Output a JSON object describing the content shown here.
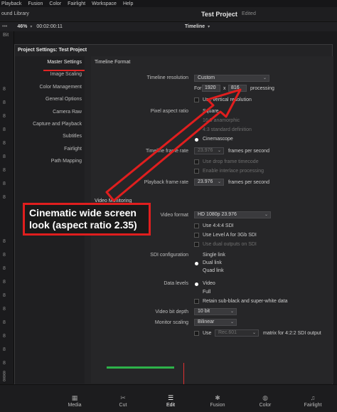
{
  "menu": [
    "Playback",
    "Fusion",
    "Color",
    "Fairlight",
    "Workspace",
    "Help"
  ],
  "titlebar": {
    "library": "ound Library",
    "project": "Test Project",
    "status": "Edited"
  },
  "toolbar": {
    "zoom": "46%",
    "timecode": "00:02:00:11",
    "timeline": "Timeline",
    "bit": "Bit"
  },
  "left_strip_numbers": [
    "8",
    "8",
    "8",
    "8",
    "8",
    "8",
    "8",
    "8",
    "8",
    "8",
    "8",
    "8",
    "8",
    "8",
    "8",
    "8",
    "8",
    "8",
    "8",
    "8",
    "8",
    "8"
  ],
  "dialog": {
    "title": "Project Settings:  Test Project",
    "nav": [
      "Master Settings",
      "Image Scaling",
      "Color Management",
      "General Options",
      "Camera Raw",
      "Capture and Playback",
      "Subtitles",
      "Fairlight",
      "Path Mapping"
    ],
    "timeline_format": {
      "heading": "Timeline Format",
      "resolution_label": "Timeline resolution",
      "resolution_value": "Custom",
      "for_label": "For",
      "width": "1920",
      "x": "x",
      "height": "816",
      "processing": "processing",
      "use_vertical": "Use vertical resolution",
      "pixel_aspect_label": "Pixel aspect ratio",
      "pixel_aspect_options": [
        "Square",
        "16:9 anamorphic",
        "4:3 standard definition",
        "Cinemascope"
      ],
      "frame_rate_label": "Timeline frame rate",
      "frame_rate_value": "23.976",
      "frame_rate_unit": "frames per second",
      "drop_frame": "Use drop frame timecode",
      "interlace": "Enable interlace processing",
      "playback_label": "Playback frame rate",
      "playback_value": "23.976",
      "playback_unit": "frames per second"
    },
    "video_monitoring": {
      "heading": "Video Monitoring",
      "format_label": "Video format",
      "format_value": "HD 1080p 23.976",
      "use_444": "Use 4:4:4 SDI",
      "use_level_a": "Use Level A for 3Gb SDI",
      "sdi_outputs": "Use dual outputs on SDI",
      "sdi_config_label": "SDI configuration",
      "sdi_options": [
        "Single link",
        "Dual link",
        "Quad link"
      ],
      "data_levels_label": "Data levels",
      "data_levels_options": [
        "Video",
        "Full"
      ],
      "retain": "Retain sub-black and super-white data",
      "bit_depth_label": "Video bit depth",
      "bit_depth_value": "10 bit",
      "scaling_label": "Monitor scaling",
      "scaling_value": "Bilinear",
      "use_label": "Use",
      "rec_value": "Rec.601",
      "matrix": "matrix for 4:2:2 SDI output"
    }
  },
  "bottom_nav": [
    {
      "label": "Media",
      "icon": "media-icon",
      "glyph": "▦"
    },
    {
      "label": "Cut",
      "icon": "cut-icon",
      "glyph": "✂"
    },
    {
      "label": "Edit",
      "icon": "edit-icon",
      "glyph": "☰"
    },
    {
      "label": "Fusion",
      "icon": "fusion-icon",
      "glyph": "✱"
    },
    {
      "label": "Color",
      "icon": "color-icon",
      "glyph": "◍"
    },
    {
      "label": "Fairlight",
      "icon": "fairlight-icon",
      "glyph": "♫"
    }
  ],
  "callout": {
    "line1": "Cinematic wide screen",
    "line2": "look (aspect ratio 2.35)"
  },
  "colors": {
    "accent_red": "#e01e1e",
    "timeline_green": "#2db24a"
  }
}
